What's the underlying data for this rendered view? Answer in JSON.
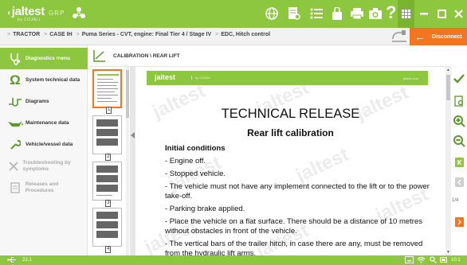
{
  "app": {
    "logo": "jaltest",
    "logo_sub": "by COJALI",
    "product": "GRP"
  },
  "breadcrumb": [
    {
      "label": "TRACTOR"
    },
    {
      "label": "CASE IH"
    },
    {
      "label": "Puma Series - CVT, engine: Final Tier 4 / Stage IV"
    },
    {
      "label": "EDC, Hitch control"
    }
  ],
  "disconnect_label": "Disconnect",
  "sidebar": {
    "items": [
      {
        "label": "Diagnostics menu",
        "icon": "stethoscope-icon",
        "active": true,
        "enabled": true
      },
      {
        "label": "System technical data",
        "icon": "omega-icon",
        "active": false,
        "enabled": true
      },
      {
        "label": "Diagrams",
        "icon": "diagram-icon",
        "active": false,
        "enabled": true
      },
      {
        "label": "Maintenance data",
        "icon": "oil-can-icon",
        "active": false,
        "enabled": true
      },
      {
        "label": "Vehicle/vessel data",
        "icon": "wrench-icon",
        "active": false,
        "enabled": true
      },
      {
        "label": "Troubleshooting by symptoms",
        "icon": "tools-icon",
        "active": false,
        "enabled": false
      },
      {
        "label": "Releases and Procedures",
        "icon": "document-icon",
        "active": false,
        "enabled": false
      }
    ]
  },
  "content": {
    "title": "CALIBRATION \\ REAR LIFT"
  },
  "thumbnails": {
    "pages": [
      "1",
      "2",
      "3",
      "4"
    ],
    "selected": "1"
  },
  "document": {
    "header_logo": "jaltest",
    "header_sub": "by COJALI",
    "header_web": "jaltest.com",
    "title": "TECHNICAL RELEASE",
    "subtitle": "Rear lift calibration",
    "section": "Initial conditions",
    "items": [
      "- Engine off.",
      "- Stopped vehicle.",
      "- The vehicle must not have any implement connected to the lift or to the power take-off.",
      "- Parking brake applied.",
      "- Place the vehicle on a flat surface. There should be a distance of 10 metres without obstacles in front of the vehicle.",
      "- The vertical bars of the trailer hitch, in case there are any, must be removed from the hydraulic lift arms."
    ]
  },
  "page_indicator": "1/4",
  "status": {
    "version": "22.1",
    "time": "10:1"
  },
  "colors": {
    "brand_green": "#8dc63f",
    "accent_orange": "#f47520"
  }
}
